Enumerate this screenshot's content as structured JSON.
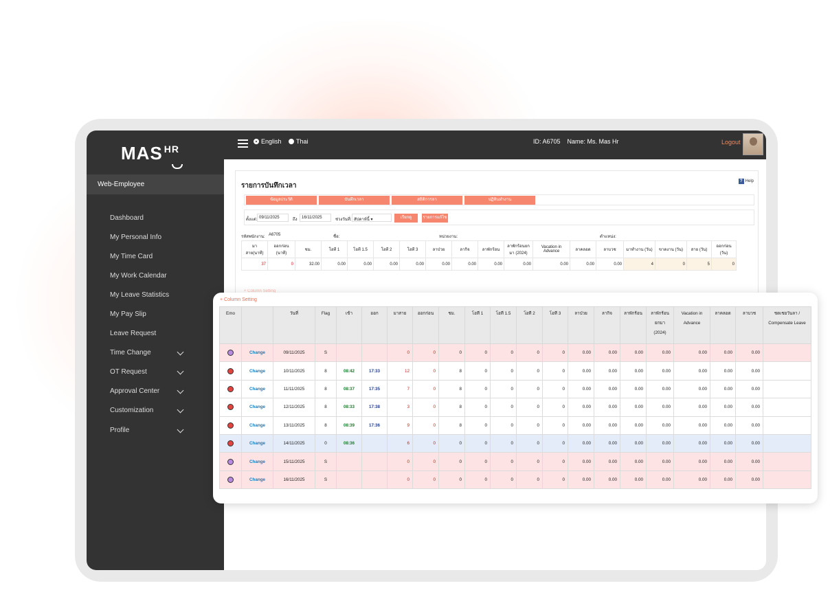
{
  "app": {
    "brand": "MAS",
    "brand_sup": "HR"
  },
  "sidebar": {
    "role": "Web-Employee",
    "items": [
      {
        "label": "Dashboard",
        "expandable": false
      },
      {
        "label": "My Personal Info",
        "expandable": false
      },
      {
        "label": "My Time Card",
        "expandable": false
      },
      {
        "label": "My Work Calendar",
        "expandable": false
      },
      {
        "label": "My Leave Statistics",
        "expandable": false
      },
      {
        "label": "My Pay Slip",
        "expandable": false
      },
      {
        "label": "Leave Request",
        "expandable": false
      },
      {
        "label": "Time Change",
        "expandable": true
      },
      {
        "label": "OT Request",
        "expandable": true
      },
      {
        "label": "Approval Center",
        "expandable": true
      },
      {
        "label": "Customization",
        "expandable": true
      },
      {
        "label": "Profile",
        "expandable": true
      }
    ]
  },
  "topbar": {
    "lang_en": "English",
    "lang_th": "Thai",
    "selected_lang": "English",
    "id_text": "ID: A6705",
    "name_text": "Name: Ms. Mas Hr",
    "logout": "Logout"
  },
  "page": {
    "title": "รายการบันทึกเวลา",
    "help": "Help",
    "tabs": [
      "ข้อมูลประวัติ",
      "บันทึกเวลา",
      "สถิติการลา",
      "ปฏิทินทำงาน"
    ],
    "filter": {
      "from_label": "ตั้งแต่:",
      "from_value": "09/11/2025",
      "to_label": "ถึง",
      "to_value": "16/11/2025",
      "range_label": "ช่วงวันที่:",
      "range_value": "สัปดาห์นี้",
      "search_btn": "เรียกดู",
      "list_btn": "รายการแก้ไข"
    },
    "info": {
      "emp_code_label": "รหัสพนักงาน:",
      "emp_code": "A6705",
      "name_label": "ชื่อ:",
      "dept_label": "หน่วยงาน:",
      "position_label": "ตำแหน่ง:"
    },
    "summary": {
      "headers": [
        "มาสาย(นาที)",
        "ออกก่อน (นาที)",
        "ชม.",
        "โอที 1",
        "โอที 1.5",
        "โอที 2",
        "โอที 3",
        "ลาป่วย",
        "ลากิจ",
        "ลาพักร้อน",
        "ลาพักร้อนยกมา (2024)",
        "Vacation in Advance",
        "ลาคลอด",
        "ลาบวช",
        "มาทำงาน (วัน)",
        "ขาดงาน (วัน)",
        "สาย (วัน)",
        "ออกก่อน (วัน)"
      ],
      "values": [
        "37",
        "0",
        "32.00",
        "0.00",
        "0.00",
        "0.00",
        "0.00",
        "0.00",
        "0.00",
        "0.00",
        "0.00",
        "0.00",
        "0.00",
        "0.00",
        "4",
        "0",
        "5",
        "0"
      ]
    },
    "column_setting_faint": "+ Column Setting"
  },
  "timecard": {
    "column_setting": "+ Column Setting",
    "headers": [
      "Emo",
      "",
      "วันที่",
      "Flag",
      "เข้า",
      "ออก",
      "มาสาย",
      "ออกก่อน",
      "ชม.",
      "โอที 1",
      "โอที 1.5",
      "โอที 2",
      "โอที 3",
      "ลาป่วย",
      "ลากิจ",
      "ลาพักร้อน",
      "ลาพักร้อน ยกมา (2024)",
      "Vacation in Advance",
      "ลาคลอด",
      "ลาบวช",
      "ชดเชยวันลา / Compensate Leave"
    ],
    "change_label": "Change",
    "rows": [
      {
        "emo": "purple",
        "row": "pink",
        "date": "09/11/2025",
        "flag": "S",
        "in": "",
        "out": "",
        "late": "0",
        "early": "0",
        "hrs": "0",
        "ot1": "0",
        "ot15": "0",
        "ot2": "0",
        "ot3": "0",
        "sick": "0.00",
        "biz": "0.00",
        "vac": "0.00",
        "vac24": "0.00",
        "vadv": "0.00",
        "mat": "0.00",
        "ord": "0.00",
        "comp": ""
      },
      {
        "emo": "sad",
        "row": "white",
        "date": "10/11/2025",
        "flag": "8",
        "in": "08:42",
        "out": "17:33",
        "late": "12",
        "early": "0",
        "hrs": "8",
        "ot1": "0",
        "ot15": "0",
        "ot2": "0",
        "ot3": "0",
        "sick": "0.00",
        "biz": "0.00",
        "vac": "0.00",
        "vac24": "0.00",
        "vadv": "0.00",
        "mat": "0.00",
        "ord": "0.00",
        "comp": ""
      },
      {
        "emo": "sad",
        "row": "white",
        "date": "11/11/2025",
        "flag": "8",
        "in": "08:37",
        "out": "17:35",
        "late": "7",
        "early": "0",
        "hrs": "8",
        "ot1": "0",
        "ot15": "0",
        "ot2": "0",
        "ot3": "0",
        "sick": "0.00",
        "biz": "0.00",
        "vac": "0.00",
        "vac24": "0.00",
        "vadv": "0.00",
        "mat": "0.00",
        "ord": "0.00",
        "comp": ""
      },
      {
        "emo": "sad",
        "row": "white",
        "date": "12/11/2025",
        "flag": "8",
        "in": "08:33",
        "out": "17:38",
        "late": "3",
        "early": "0",
        "hrs": "8",
        "ot1": "0",
        "ot15": "0",
        "ot2": "0",
        "ot3": "0",
        "sick": "0.00",
        "biz": "0.00",
        "vac": "0.00",
        "vac24": "0.00",
        "vadv": "0.00",
        "mat": "0.00",
        "ord": "0.00",
        "comp": ""
      },
      {
        "emo": "sad",
        "row": "white",
        "date": "13/11/2025",
        "flag": "8",
        "in": "08:39",
        "out": "17:36",
        "late": "9",
        "early": "0",
        "hrs": "8",
        "ot1": "0",
        "ot15": "0",
        "ot2": "0",
        "ot3": "0",
        "sick": "0.00",
        "biz": "0.00",
        "vac": "0.00",
        "vac24": "0.00",
        "vadv": "0.00",
        "mat": "0.00",
        "ord": "0.00",
        "comp": ""
      },
      {
        "emo": "sad",
        "row": "blue",
        "date": "14/11/2025",
        "flag": "0",
        "in": "08:36",
        "out": "",
        "late": "6",
        "early": "0",
        "hrs": "0",
        "ot1": "0",
        "ot15": "0",
        "ot2": "0",
        "ot3": "0",
        "sick": "0.00",
        "biz": "0.00",
        "vac": "0.00",
        "vac24": "0.00",
        "vadv": "0.00",
        "mat": "0.00",
        "ord": "0.00",
        "comp": ""
      },
      {
        "emo": "purple",
        "row": "pink",
        "date": "15/11/2025",
        "flag": "S",
        "in": "",
        "out": "",
        "late": "0",
        "early": "0",
        "hrs": "0",
        "ot1": "0",
        "ot15": "0",
        "ot2": "0",
        "ot3": "0",
        "sick": "0.00",
        "biz": "0.00",
        "vac": "0.00",
        "vac24": "0.00",
        "vadv": "0.00",
        "mat": "0.00",
        "ord": "0.00",
        "comp": ""
      },
      {
        "emo": "purple",
        "row": "pink",
        "date": "16/11/2025",
        "flag": "S",
        "in": "",
        "out": "",
        "late": "0",
        "early": "0",
        "hrs": "0",
        "ot1": "0",
        "ot15": "0",
        "ot2": "0",
        "ot3": "0",
        "sick": "0.00",
        "biz": "0.00",
        "vac": "0.00",
        "vac24": "0.00",
        "vadv": "0.00",
        "mat": "0.00",
        "ord": "0.00",
        "comp": ""
      }
    ]
  },
  "colors": {
    "accent": "#f6866e",
    "dark": "#333333",
    "link": "#1a7abf",
    "row_pink": "#fde3e3",
    "row_blue": "#e3ecf8"
  }
}
